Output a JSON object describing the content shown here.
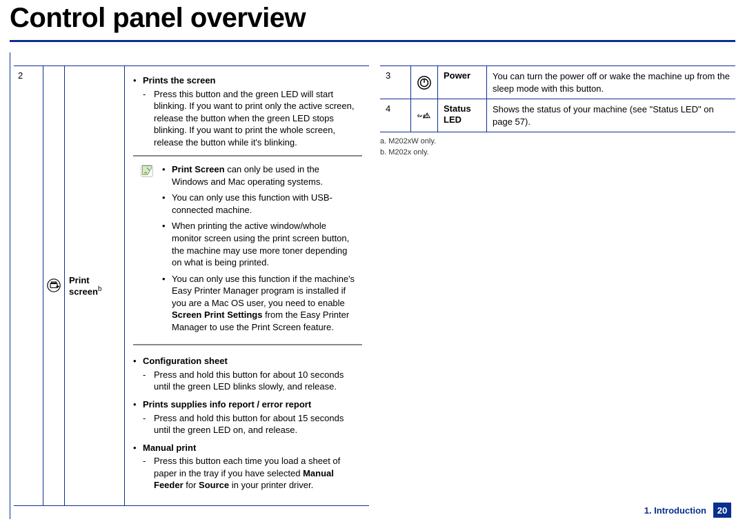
{
  "heading": "Control panel overview",
  "left": {
    "num": "2",
    "name_line1": "Print",
    "name_line2": "screen",
    "name_sup": "b",
    "sec1_title": "Prints the screen",
    "sec1_item": "Press this button and the green LED will start blinking. If you want to print only the active screen, release the button when the green LED stops blinking. If you want to print the whole screen, release the button while it's blinking.",
    "note_b1_pre": "Print Screen",
    "note_b1_post": " can only be used in the Windows and Mac operating systems.",
    "note_b2": "You can only use this function with USB-connected machine.",
    "note_b3": "When printing the active window/whole monitor screen using the print screen button, the machine may use more toner depending on what is being printed.",
    "note_b4_pre": "You can only use this function if the machine's Easy Printer Manager program is installed if you are a Mac OS user, you need to enable ",
    "note_b4_bold": "Screen Print Settings",
    "note_b4_post": " from the Easy Printer Manager to use the Print Screen feature.",
    "sec2_title": "Configuration sheet",
    "sec2_item": "Press and hold this button for about 10 seconds until the green LED blinks slowly, and release.",
    "sec3_title": "Prints supplies info report / error report",
    "sec3_item": "Press and hold this button for about 15 seconds until the green LED on, and release.",
    "sec4_title": "Manual print",
    "sec4_pre": "Press this button each time you load a sheet of paper in the tray if you have selected ",
    "sec4_b1": "Manual Feeder",
    "sec4_mid": " for ",
    "sec4_b2": "Source",
    "sec4_post": " in your printer driver."
  },
  "right": {
    "r1_num": "3",
    "r1_name": "Power",
    "r1_body": "You can turn the power off or wake the machine up from the sleep mode with this button.",
    "r2_num": "4",
    "r2_name_l1": "Status",
    "r2_name_l2": "LED",
    "r2_body": "Shows the status of your machine (see \"Status LED\" on page 57).",
    "fn_a": "a.  M202xW only.",
    "fn_b": "b. M202x only."
  },
  "footer": {
    "chapter": "1. Introduction",
    "page": "20"
  }
}
